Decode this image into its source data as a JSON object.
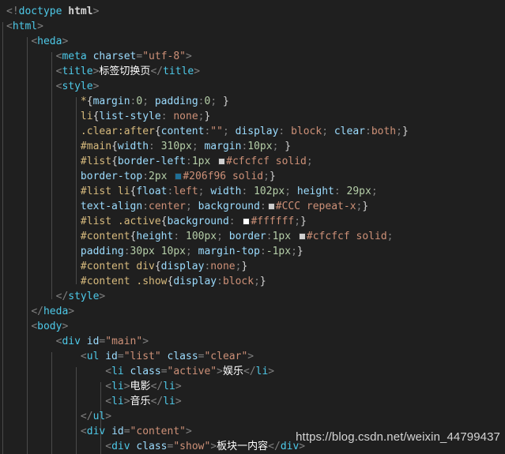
{
  "editor": {
    "background": "#1f1f1f",
    "indent_guide_color": "#5a5a5a",
    "language": "html"
  },
  "watermark": {
    "text": "https://blog.csdn.net/weixin_44799437"
  },
  "palette": {
    "tag": "#4ec9e8",
    "tag_keyword": "#d4d4d4",
    "attribute": "#9cdcfe",
    "string": "#ce9178",
    "selector": "#d7ba7d",
    "property": "#9cdcfe",
    "value": "#ce9178",
    "number": "#b5cea8",
    "punctuation": "#808080",
    "text": "#ffffff"
  },
  "swatches": {
    "cfcfcf": "#cfcfcf",
    "206f96": "#206f96",
    "ccc": "#cccccc",
    "ffffff": "#ffffff"
  },
  "code": {
    "lines": [
      {
        "indent": 0,
        "text": "<!doctype html>"
      },
      {
        "indent": 0,
        "text": "<html>"
      },
      {
        "indent": 1,
        "text": "<heda>"
      },
      {
        "indent": 2,
        "text": "<meta charset=\"utf-8\">"
      },
      {
        "indent": 2,
        "text": "<title>标签切换页</title>"
      },
      {
        "indent": 2,
        "text": "<style>"
      },
      {
        "indent": 3,
        "text": "*{margin:0; padding:0; }"
      },
      {
        "indent": 3,
        "text": "li{list-style: none;}"
      },
      {
        "indent": 3,
        "text": ".clear:after{content:\"\"; display: block; clear:both;}"
      },
      {
        "indent": 3,
        "text": "#main{width: 310px; margin:10px; }"
      },
      {
        "indent": 3,
        "text": "#list{border-left:1px #cfcfcf solid;"
      },
      {
        "indent": 3,
        "text": "border-top:2px #206f96 solid;}"
      },
      {
        "indent": 3,
        "text": "#list li{float:left; width: 102px; height: 29px;"
      },
      {
        "indent": 3,
        "text": "text-align:center; background:#CCC repeat-x;}"
      },
      {
        "indent": 3,
        "text": "#list .active{background: #ffffff;}"
      },
      {
        "indent": 3,
        "text": "#content{height: 100px; border:1px #cfcfcf solid;"
      },
      {
        "indent": 3,
        "text": "padding:30px 10px; margin-top:-1px;}"
      },
      {
        "indent": 3,
        "text": "#content div{display:none;}"
      },
      {
        "indent": 3,
        "text": "#content .show{display:block;}"
      },
      {
        "indent": 2,
        "text": "</style>"
      },
      {
        "indent": 1,
        "text": "</heda>"
      },
      {
        "indent": 1,
        "text": "<body>"
      },
      {
        "indent": 2,
        "text": "<div id=\"main\">"
      },
      {
        "indent": 3,
        "text": "<ul id=\"list\" class=\"clear\">"
      },
      {
        "indent": 4,
        "text": "<li class=\"active\">娱乐</li>"
      },
      {
        "indent": 4,
        "text": "<li>电影</li>"
      },
      {
        "indent": 4,
        "text": "<li>音乐</li>"
      },
      {
        "indent": 3,
        "text": "</ul>"
      },
      {
        "indent": 3,
        "text": "<div id=\"content\">"
      },
      {
        "indent": 4,
        "text": "<div class=\"show\">板块一内容</div>"
      }
    ]
  }
}
